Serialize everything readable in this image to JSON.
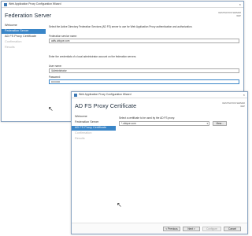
{
  "back_window": {
    "title": "Web Application Proxy Configuration Wizard",
    "close": "×",
    "header_title": "Federation Server",
    "server_label": "DESTINATION SERVER",
    "server_name": "WAP",
    "nav": [
      "Welcome",
      "Federation Server",
      "AD FS Proxy Certificate",
      "Confirmation",
      "Results"
    ],
    "instructions": "Select the Active Directory Federation Services (AD FS) server to use for Web Application Proxy authentication and authorization.",
    "service_name_label": "Federation service name:",
    "service_name_value": "adfs.ubique.com",
    "credentials_text": "Enter the credentials of a local administrator account on the federation servers.",
    "username_label": "User name:",
    "username_value": "\\Administrator",
    "password_label": "Password:",
    "password_value": "••••••••••"
  },
  "front_window": {
    "title": "Web Application Proxy Configuration Wizard",
    "close": "×",
    "header_title": "AD FS Proxy Certificate",
    "server_label": "DESTINATION SERVER",
    "server_name": "WAP",
    "nav": [
      "Welcome",
      "Federation Server",
      "AD FS Proxy Certificate",
      "Confirmation",
      "Results"
    ],
    "instructions": "Select a certificate to be used by the AD FS proxy:",
    "certificate_value": "*.ubique.com",
    "view_button": "View...",
    "previous_button": "< Previous",
    "next_button": "Next >",
    "configure_button": "Configure",
    "cancel_button": "Cancel"
  }
}
